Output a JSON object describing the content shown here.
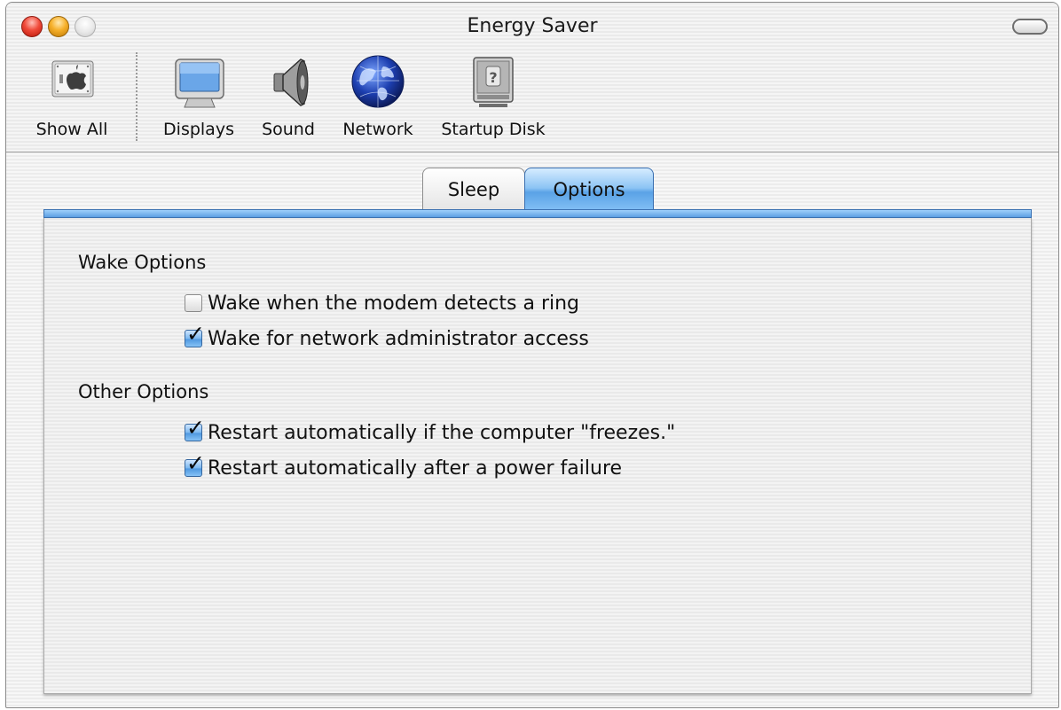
{
  "window": {
    "title": "Energy Saver"
  },
  "toolbar": {
    "items": [
      {
        "label": "Show All",
        "icon": "show-all-icon"
      },
      {
        "label": "Displays",
        "icon": "displays-icon"
      },
      {
        "label": "Sound",
        "icon": "speaker-icon"
      },
      {
        "label": "Network",
        "icon": "globe-icon"
      },
      {
        "label": "Startup Disk",
        "icon": "hard-disk-icon"
      }
    ]
  },
  "tabs": [
    {
      "label": "Sleep",
      "selected": false
    },
    {
      "label": "Options",
      "selected": true
    }
  ],
  "sections": [
    {
      "title": "Wake Options",
      "options": [
        {
          "label": "Wake when the modem detects a ring",
          "checked": false
        },
        {
          "label": "Wake for network administrator access",
          "checked": true
        }
      ]
    },
    {
      "title": "Other Options",
      "options": [
        {
          "label": "Restart automatically if the computer \"freezes.\"",
          "checked": true
        },
        {
          "label": "Restart automatically after a power failure",
          "checked": true
        }
      ]
    }
  ],
  "colors": {
    "accent": "#5aa2e6",
    "close": "#f04a3a",
    "minimize": "#f6b02a"
  }
}
